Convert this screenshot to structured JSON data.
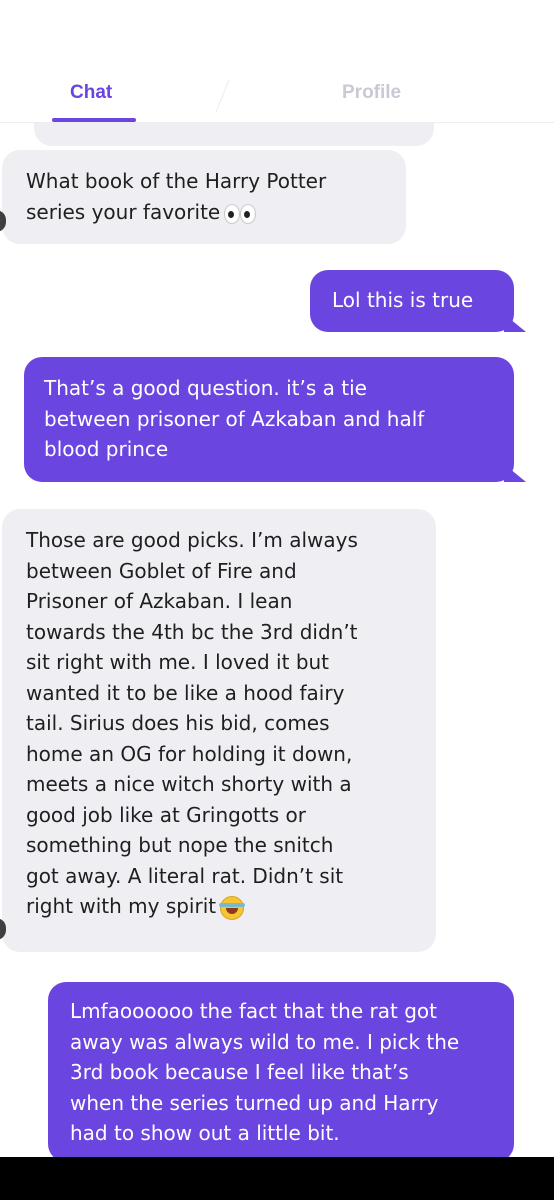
{
  "tabs": {
    "chat": "Chat",
    "profile": "Profile"
  },
  "messages": [
    {
      "direction": "incoming",
      "lines": [
        "What book of the Harry Potter",
        "series your favorite"
      ],
      "emoji": "eyes-icon"
    },
    {
      "direction": "outgoing",
      "lines": [
        "Lol this is true"
      ]
    },
    {
      "direction": "outgoing",
      "lines": [
        "That’s a good question. it’s a tie",
        "between prisoner of Azkaban and half",
        "blood prince"
      ]
    },
    {
      "direction": "incoming",
      "lines": [
        "Those are good picks. I’m always",
        "between Goblet of Fire and",
        "Prisoner of Azkaban. I lean",
        "towards the 4th bc the 3rd didn’t",
        "sit right with me. I loved it but",
        "wanted it to be like a hood fairy",
        "tail. Sirius does his bid, comes",
        "home an OG for holding it down,",
        "meets a nice witch shorty with a",
        "good job like at Gringotts or",
        "something but nope the snitch",
        "got away. A literal rat. Didn’t sit",
        "right with my spirit"
      ],
      "emoji": "laughing-tears-icon"
    },
    {
      "direction": "outgoing",
      "lines": [
        "Lmfaoooooo the fact that the rat got",
        "away was always wild to me. I pick the",
        "3rd book because I feel like that’s",
        "when the series turned up and Harry",
        "had to show out a little bit."
      ]
    }
  ],
  "colors": {
    "accent": "#6a45e0",
    "incoming_bubble": "#efeff3",
    "inactive_tab": "#c9c9d6"
  }
}
